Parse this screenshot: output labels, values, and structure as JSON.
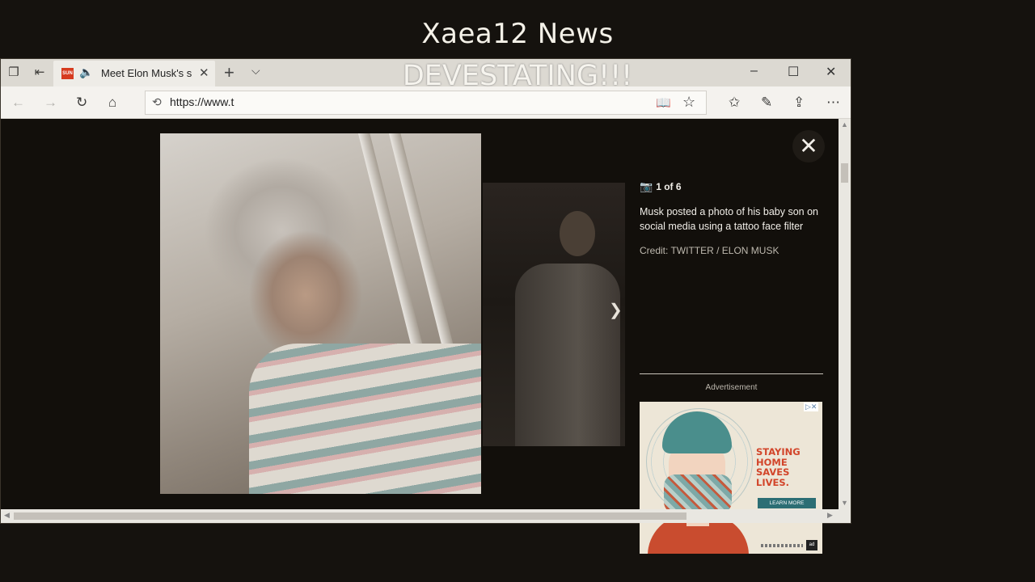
{
  "video_title": "Xaea12 News",
  "overlay_banner": "DEVESTATING!!!",
  "browser": {
    "tab": {
      "favicon_text": "SUN",
      "title": "Meet Elon Musk's s",
      "close_glyph": "✕"
    },
    "tab_actions": {
      "new_tab_glyph": "+",
      "tab_list_glyph": "⌵"
    },
    "window_controls": {
      "minimize": "–",
      "maximize": "☐",
      "close": "✕"
    },
    "address_bar": {
      "url": "https://www.t"
    },
    "icons": {
      "back": "back-arrow-icon",
      "forward": "forward-arrow-icon",
      "refresh": "refresh-icon",
      "home": "home-icon",
      "reading_view": "book-icon",
      "favorite": "star-icon",
      "favorites_hub": "favorites-list-icon",
      "notes": "pen-icon",
      "share": "share-icon",
      "more": "more-icon"
    }
  },
  "gallery": {
    "counter": "1 of 6",
    "caption": "Musk posted a photo of his baby son on social media using a tattoo face filter",
    "credit": "Credit: TWITTER / ELON MUSK",
    "ad_label": "Advertisement",
    "ad": {
      "headline": "STAYING HOME SAVES LIVES.",
      "cta": "LEARN MORE",
      "badge": "ad",
      "accent_color": "#d2452a"
    }
  }
}
